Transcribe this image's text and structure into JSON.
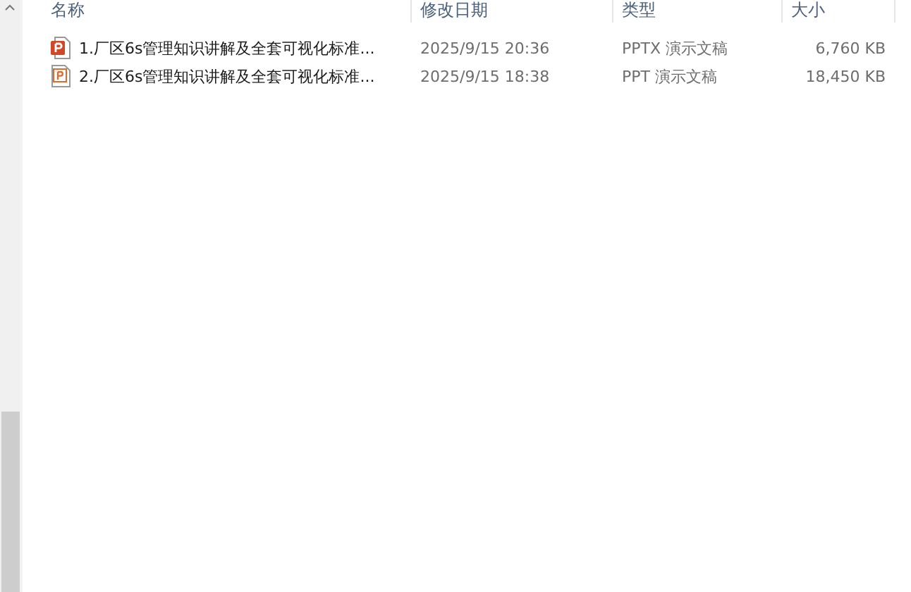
{
  "columns": [
    {
      "label": "名称"
    },
    {
      "label": "修改日期"
    },
    {
      "label": "类型"
    },
    {
      "label": "大小"
    }
  ],
  "files": [
    {
      "name": "1.厂区6s管理知识讲解及全套可视化标准...",
      "modified": "2025/9/15 20:36",
      "type": "PPTX 演示文稿",
      "size": "6,760 KB",
      "kind": "pptx"
    },
    {
      "name": "2.厂区6s管理知识讲解及全套可视化标准...",
      "modified": "2025/9/15 18:38",
      "type": "PPT 演示文稿",
      "size": "18,450 KB",
      "kind": "ppt"
    }
  ]
}
